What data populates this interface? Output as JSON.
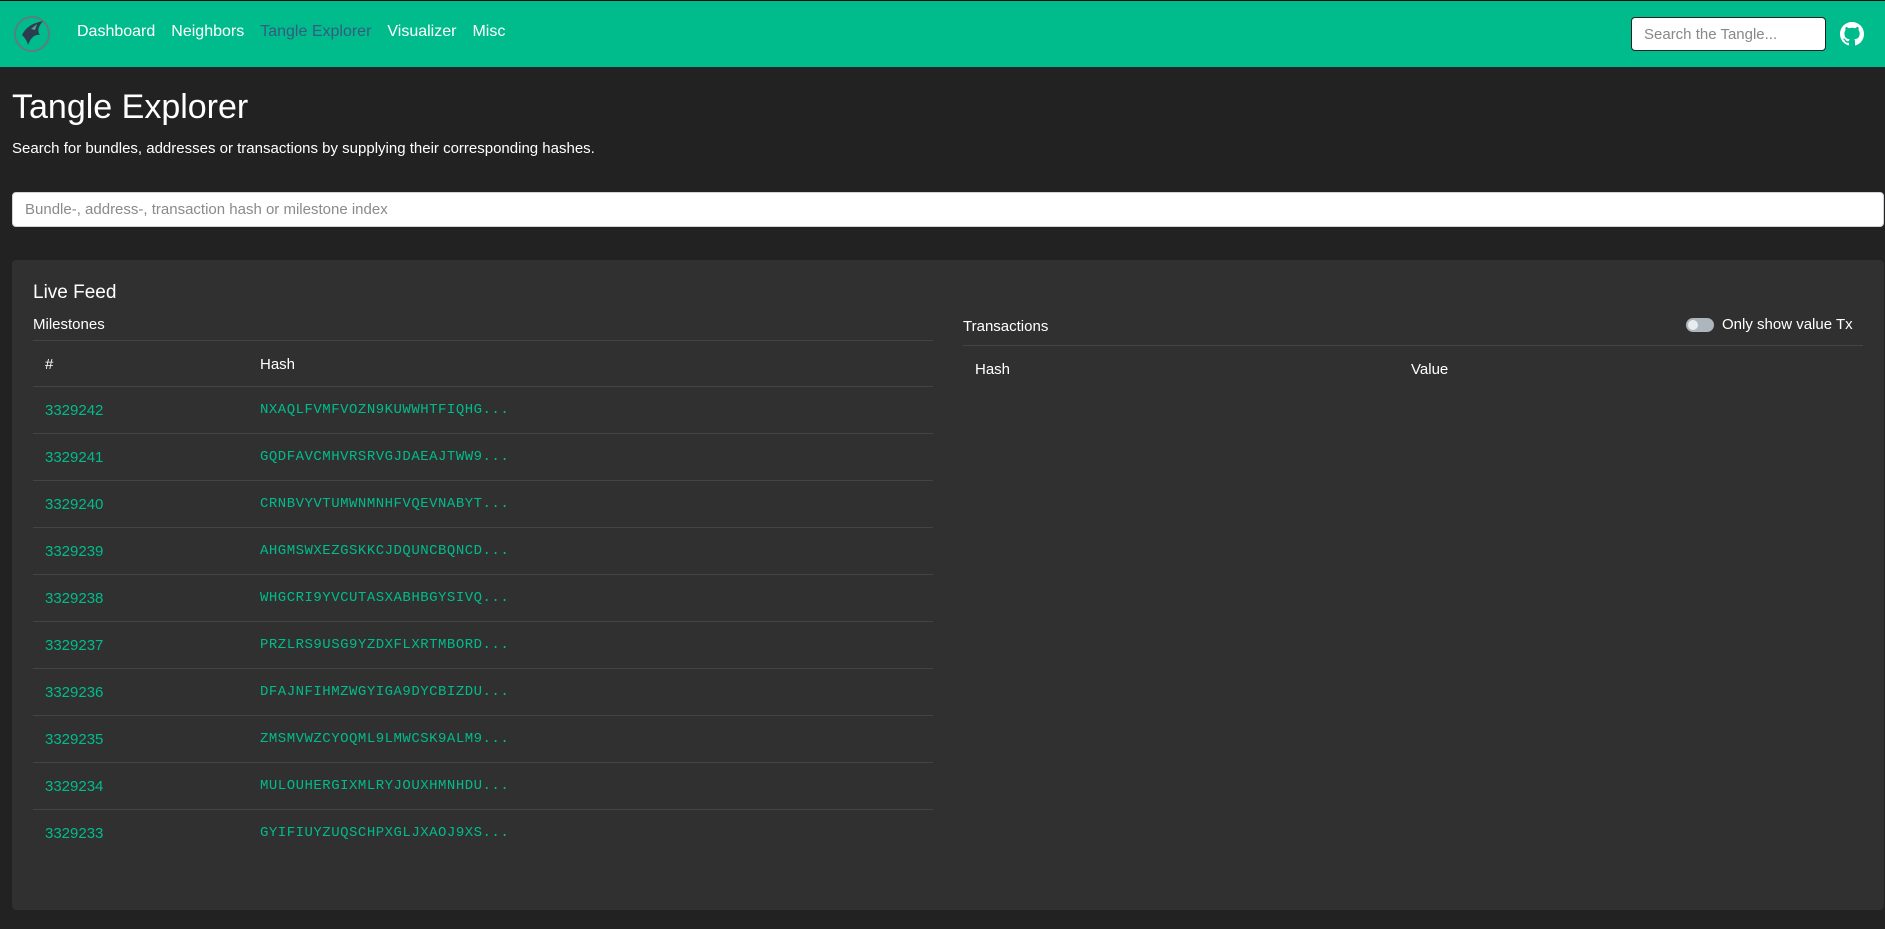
{
  "navbar": {
    "links": [
      {
        "label": "Dashboard"
      },
      {
        "label": "Neighbors"
      },
      {
        "label": "Tangle Explorer"
      },
      {
        "label": "Visualizer"
      },
      {
        "label": "Misc"
      }
    ],
    "active_link": "Tangle Explorer",
    "search_placeholder": "Search the Tangle...",
    "icons": {
      "logo": "hummingbird-logo-icon",
      "github": "github-icon"
    },
    "bg_color": "#00bc8c",
    "active_color": "#375a7f"
  },
  "header": {
    "title": "Tangle Explorer",
    "subtitle": "Search for bundles, addresses or transactions by supplying their corresponding hashes.",
    "search_placeholder": "Bundle-, address-, transaction hash or milestone index"
  },
  "live_feed": {
    "title": "Live Feed",
    "milestones": {
      "label": "Milestones",
      "columns": [
        "#",
        "Hash"
      ],
      "rows": [
        {
          "index": "3329242",
          "hash": "NXAQLFVMFVOZN9KUWWHTFIQHG..."
        },
        {
          "index": "3329241",
          "hash": "GQDFAVCMHVRSRVGJDAEAJTWW9..."
        },
        {
          "index": "3329240",
          "hash": "CRNBVYVTUMWNMNHFVQEVNABYT..."
        },
        {
          "index": "3329239",
          "hash": "AHGMSWXEZGSKKCJDQUNCBQNCD..."
        },
        {
          "index": "3329238",
          "hash": "WHGCRI9YVCUTASXABHBGYSIVQ..."
        },
        {
          "index": "3329237",
          "hash": "PRZLRS9USG9YZDXFLXRTMBORD..."
        },
        {
          "index": "3329236",
          "hash": "DFAJNFIHMZWGYIGA9DYCBIZDU..."
        },
        {
          "index": "3329235",
          "hash": "ZMSMVWZCYOQML9LMWCSK9ALM9..."
        },
        {
          "index": "3329234",
          "hash": "MULOUHERGIXMLRYJOUXHMNHDU..."
        },
        {
          "index": "3329233",
          "hash": "GYIFIUYZUQSCHPXGLJXAOJ9XS..."
        }
      ]
    },
    "transactions": {
      "label": "Transactions",
      "toggle_label": "Only show value Tx",
      "toggle_on": false,
      "columns": [
        "Hash",
        "Value"
      ],
      "rows": []
    },
    "link_color": "#00bc8c"
  }
}
